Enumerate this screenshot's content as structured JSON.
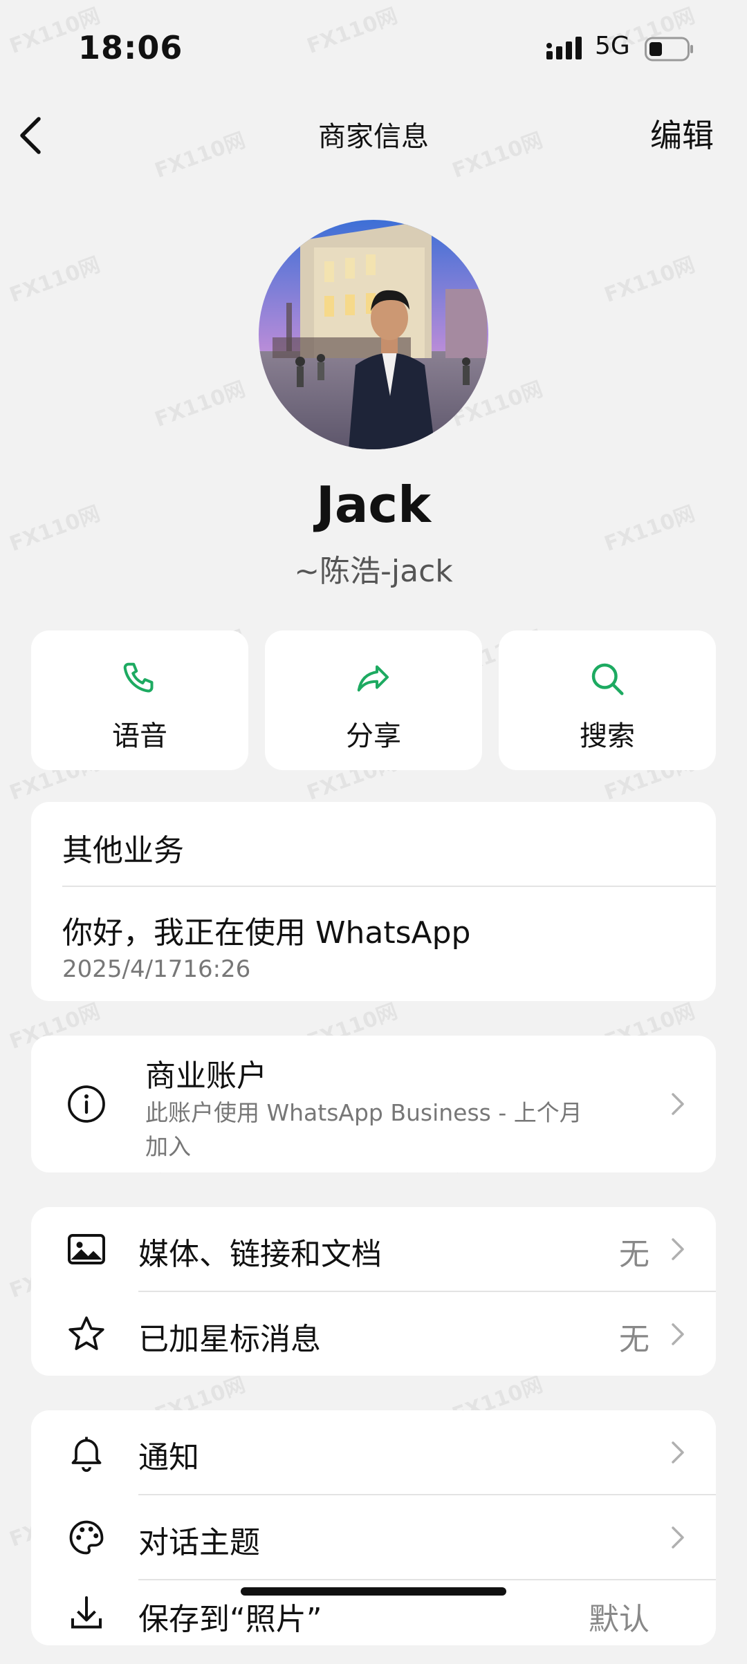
{
  "status_bar": {
    "time": "18:06",
    "network": "5G"
  },
  "nav": {
    "title": "商家信息",
    "edit_label": "编辑"
  },
  "profile": {
    "name": "Jack",
    "subtitle": "~陈浩-jack"
  },
  "actions": [
    {
      "label": "语音",
      "icon": "phone-icon"
    },
    {
      "label": "分享",
      "icon": "share-icon"
    },
    {
      "label": "搜索",
      "icon": "search-icon"
    }
  ],
  "about": {
    "header": "其他业务",
    "status_text": "你好，我正在使用 WhatsApp",
    "status_date": "2025/4/1716:26"
  },
  "business": {
    "title": "商业账户",
    "description_line1": "此账户使用 WhatsApp Business - 上个月",
    "description_line2": "加入",
    "icon": "info-icon"
  },
  "media_section": [
    {
      "label": "媒体、链接和文档",
      "value": "无",
      "icon": "image-icon"
    },
    {
      "label": "已加星标消息",
      "value": "无",
      "icon": "star-icon"
    }
  ],
  "settings_section": [
    {
      "label": "通知",
      "icon": "bell-icon"
    },
    {
      "label": "对话主题",
      "icon": "palette-icon"
    },
    {
      "label": "保存到“照片”",
      "value": "默认",
      "icon": "save-icon"
    }
  ],
  "watermark_text": "FX110网",
  "colors": {
    "accent": "#1daa61",
    "background": "#f2f2f2",
    "card": "#ffffff"
  }
}
